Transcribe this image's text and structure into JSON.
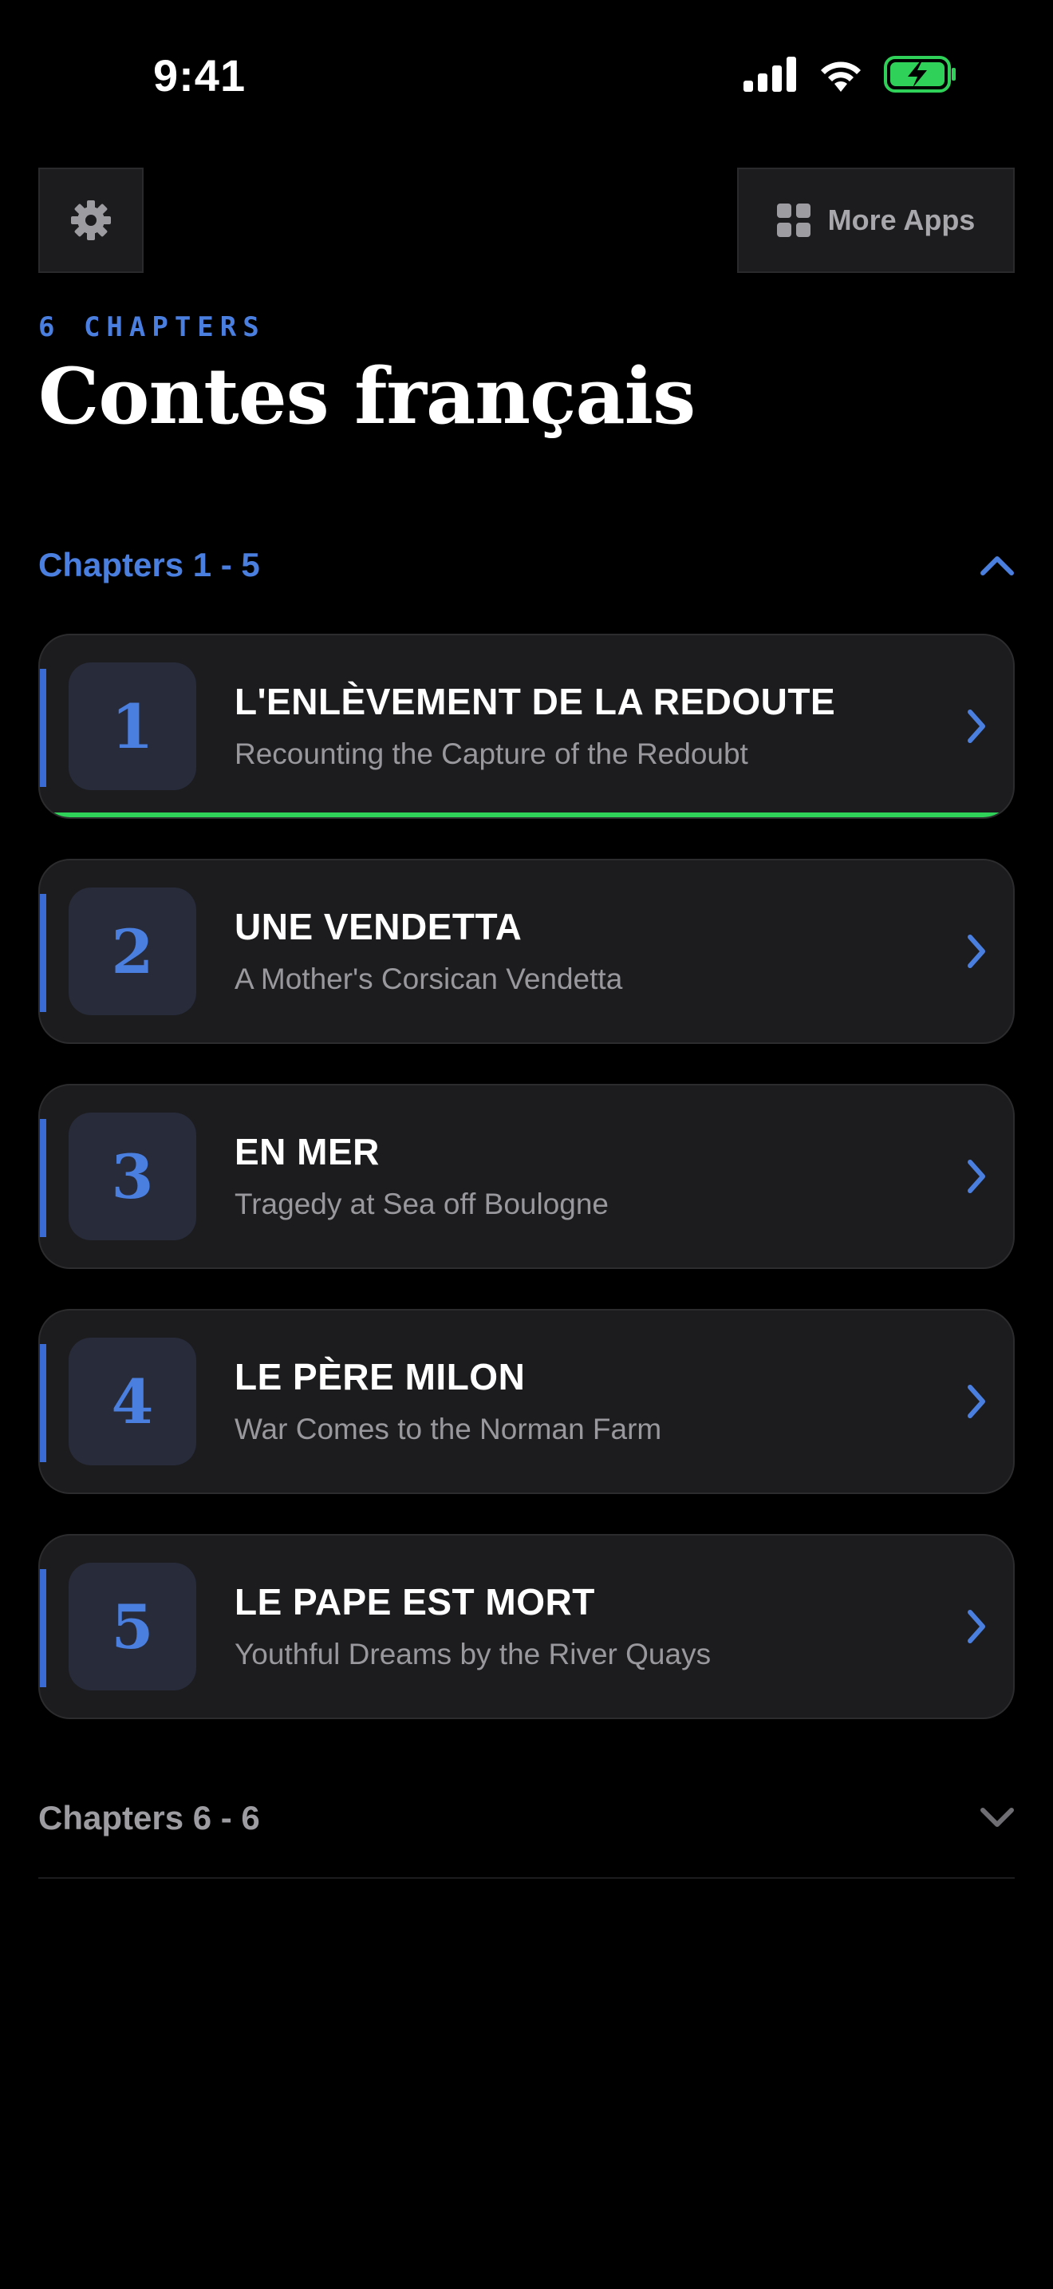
{
  "status_bar": {
    "time": "9:41"
  },
  "toolbar": {
    "settings_icon": "gear-icon",
    "more_apps_icon": "grid-icon",
    "more_apps_label": "More Apps"
  },
  "header": {
    "overline": "6 CHAPTERS",
    "title": "Contes français"
  },
  "sections": [
    {
      "label": "Chapters 1 - 5",
      "expanded": true,
      "chapters": [
        {
          "number": "1",
          "title": "L'ENLÈVEMENT DE LA REDOUTE",
          "subtitle": "Recounting the Capture of the Redoubt",
          "progress": 1.0
        },
        {
          "number": "2",
          "title": "UNE VENDETTA",
          "subtitle": "A Mother's Corsican Vendetta"
        },
        {
          "number": "3",
          "title": "EN MER",
          "subtitle": "Tragedy at Sea off Boulogne"
        },
        {
          "number": "4",
          "title": "LE PÈRE MILON",
          "subtitle": "War Comes to the Norman Farm"
        },
        {
          "number": "5",
          "title": "LE PAPE EST MORT",
          "subtitle": "Youthful Dreams by the River Quays"
        }
      ]
    },
    {
      "label": "Chapters 6 - 6",
      "expanded": false
    }
  ],
  "colors": {
    "accent": "#4a7fe0",
    "progress": "#30d158",
    "card_bg": "#1c1c1e",
    "battery": "#30d158"
  }
}
